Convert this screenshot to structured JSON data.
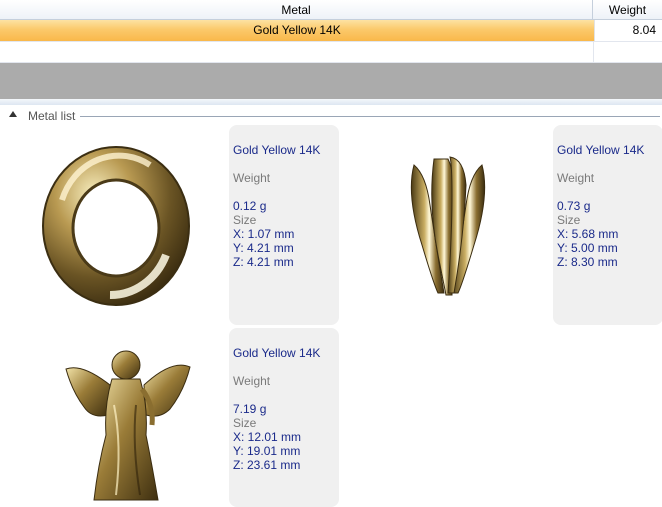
{
  "grid": {
    "columns": {
      "metal": "Metal",
      "weight": "Weight"
    },
    "rows": [
      {
        "metal": "Gold Yellow 14K",
        "weight": "8.04"
      }
    ]
  },
  "metal_list": {
    "title": "Metal list",
    "weight_label": "Weight",
    "size_label": "Size",
    "items": [
      {
        "name": "Gold Yellow 14K",
        "weight": "0.12 g",
        "x": "X: 1.07 mm",
        "y": "Y: 4.21 mm",
        "z": "Z: 4.21 mm",
        "icon": "ring-bail-icon"
      },
      {
        "name": "Gold Yellow 14K",
        "weight": "0.73 g",
        "x": "X: 5.68 mm",
        "y": "Y: 5.00 mm",
        "z": "Z: 8.30 mm",
        "icon": "pendant-cap-icon"
      },
      {
        "name": "Gold Yellow 14K",
        "weight": "7.19 g",
        "x": "X: 12.01 mm",
        "y": "Y: 19.01 mm",
        "z": "Z: 23.61 mm",
        "icon": "angel-figure-icon"
      }
    ]
  }
}
